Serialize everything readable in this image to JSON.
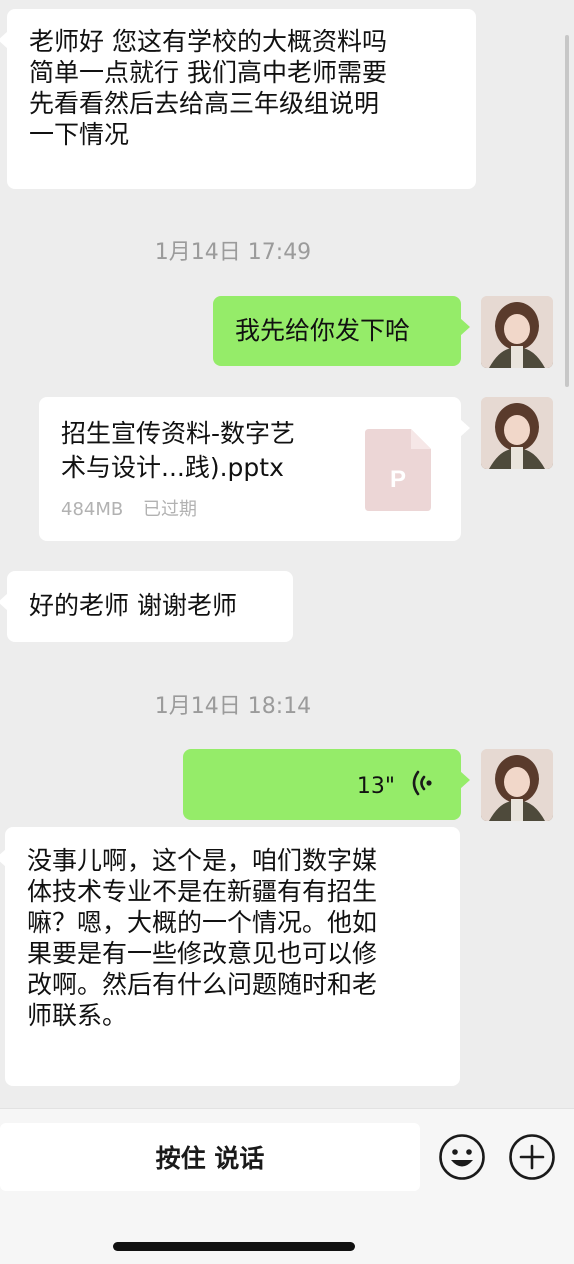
{
  "messages": {
    "m1": "老师好 您这有学校的大概资料吗\n简单一点就行 我们高中老师需要\n先看看然后去给高三年级组说明\n一下情况",
    "ts1": "1月14日 17:49",
    "m2": "我先给你发下哈",
    "file": {
      "name": "招生宣传资料-数字艺\n术与设计...践).pptx",
      "size": "484MB",
      "status": "已过期",
      "icon_letter": "P"
    },
    "m3": "好的老师 谢谢老师",
    "ts2": "1月14日 18:14",
    "voice": {
      "duration": "13\""
    },
    "m4": "没事儿啊，这个是，咱们数字媒\n体技术专业不是在新疆有有招生\n嘛？嗯，大概的一个情况。他如\n果要是有一些修改意见也可以修\n改啊。然后有什么问题随时和老\n师联系。"
  },
  "input_bar": {
    "hold_to_talk": "按住 说话",
    "emoji_icon": "emoji-icon",
    "plus_icon": "plus-icon"
  },
  "colors": {
    "background": "#ededed",
    "sent_bubble": "#95ec69",
    "received_bubble": "#ffffff",
    "file_icon": "#e8cfcf"
  }
}
